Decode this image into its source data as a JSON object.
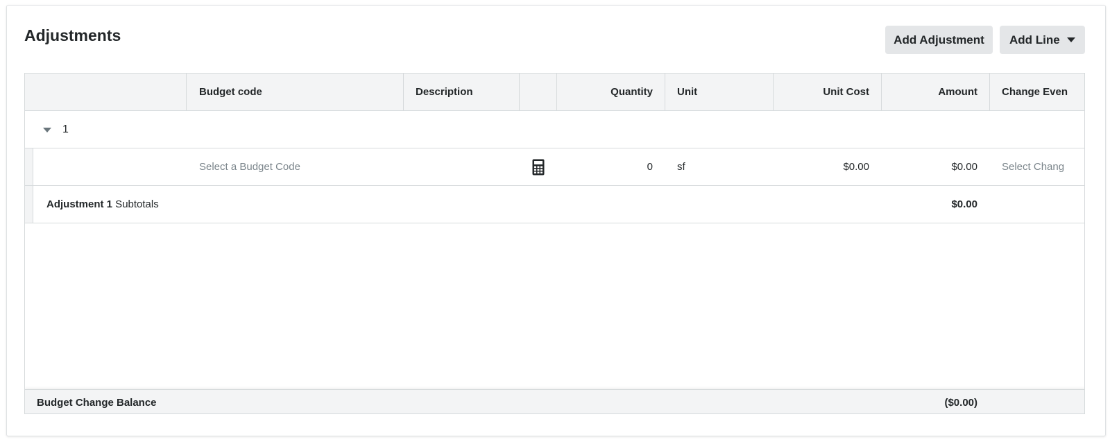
{
  "page": {
    "title": "Adjustments"
  },
  "toolbar": {
    "add_adjustment_label": "Add Adjustment",
    "add_line_label": "Add Line"
  },
  "table": {
    "columns": [
      "",
      "Budget code",
      "Description",
      "",
      "Quantity",
      "Unit",
      "Unit Cost",
      "Amount",
      "Change Even"
    ],
    "group": {
      "label": "1"
    },
    "line": {
      "budget_code_placeholder": "Select a Budget Code",
      "calculator_icon": "calculator-icon",
      "quantity": "0",
      "unit": "sf",
      "unit_cost": "$0.00",
      "amount": "$0.00",
      "change_event_placeholder": "Select Chang"
    },
    "subtotal": {
      "name": "Adjustment 1",
      "suffix": " Subtotals",
      "amount": "$0.00"
    },
    "balance": {
      "label": "Budget Change Balance",
      "amount": "($0.00)"
    }
  },
  "colors": {
    "header_bg": "#f3f4f5",
    "button_bg": "#e4e6e8",
    "border": "#d6dadc",
    "text": "#232729",
    "placeholder": "#7b858b"
  }
}
